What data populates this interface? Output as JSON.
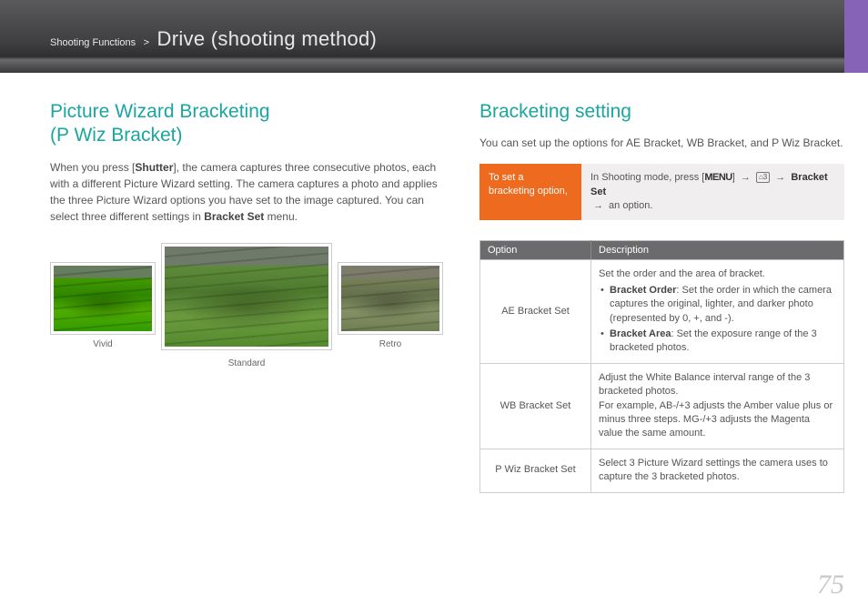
{
  "header": {
    "breadcrumb_small": "Shooting Functions",
    "breadcrumb_sep": ">",
    "breadcrumb_big": "Drive (shooting method)"
  },
  "left": {
    "title_line1": "Picture Wizard Bracketing",
    "title_line2": "(P Wiz Bracket)",
    "para_a": "When you press [",
    "para_b_bold": "Shutter",
    "para_c": "], the camera captures three consecutive photos, each with a different Picture Wizard setting. The camera captures a photo and applies the three Picture Wizard options you have set to the image captured. You can select three different settings in ",
    "para_d_bold": "Bracket Set",
    "para_e": " menu.",
    "caption_vivid": "Vivid",
    "caption_standard": "Standard",
    "caption_retro": "Retro"
  },
  "right": {
    "title": "Bracketing setting",
    "intro": "You can set up the options for AE Bracket, WB Bracket, and P Wiz Bracket.",
    "orange_label_1": "To set a",
    "orange_label_2": "bracketing option,",
    "desc_a": "In Shooting mode, press [",
    "desc_menu": "MENU",
    "desc_b": "]",
    "desc_arrow": "→",
    "desc_mode_icon": "⌂3",
    "desc_c_bold": "Bracket Set",
    "desc_d": " an option.",
    "table": {
      "th_option": "Option",
      "th_desc": "Description",
      "rows": [
        {
          "name": "AE Bracket Set",
          "lead": "Set the order and the area of bracket.",
          "items": [
            {
              "b": "Bracket Order",
              "t": ": Set the order in which the camera captures the original, lighter, and darker photo (represented by 0, +, and -)."
            },
            {
              "b": "Bracket Area",
              "t": ": Set the exposure range of the 3 bracketed photos."
            }
          ]
        },
        {
          "name": "WB Bracket Set",
          "lead": "Adjust the White Balance interval range of the 3 bracketed photos.",
          "text2": "For example, AB-/+3 adjusts the Amber value plus or minus three steps. MG-/+3 adjusts the Magenta value the same amount."
        },
        {
          "name": "P Wiz Bracket Set",
          "lead": "Select 3 Picture Wizard settings the camera uses to capture the 3 bracketed photos."
        }
      ]
    }
  },
  "page_number": "75"
}
